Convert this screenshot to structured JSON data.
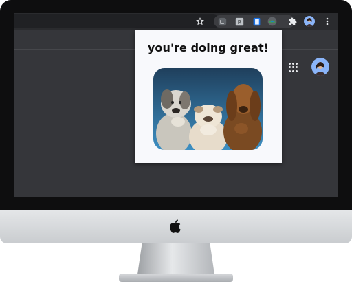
{
  "popup": {
    "title": "you're doing great!",
    "image_alt": "three dogs"
  },
  "toolbar": {
    "icons": [
      "bookmark-star-icon",
      "extension-1-icon",
      "extension-r-icon",
      "extension-book-icon",
      "extension-active-icon",
      "puzzle-extensions-icon",
      "profile-avatar",
      "more-menu-icon"
    ]
  },
  "page": {
    "icons": [
      "google-apps-icon",
      "account-avatar"
    ]
  },
  "colors": {
    "bezel": "#0e0e0f",
    "browser_bg": "#35363a",
    "toolbar": "#2a2b2e",
    "popup_bg": "#f8f9fc"
  }
}
